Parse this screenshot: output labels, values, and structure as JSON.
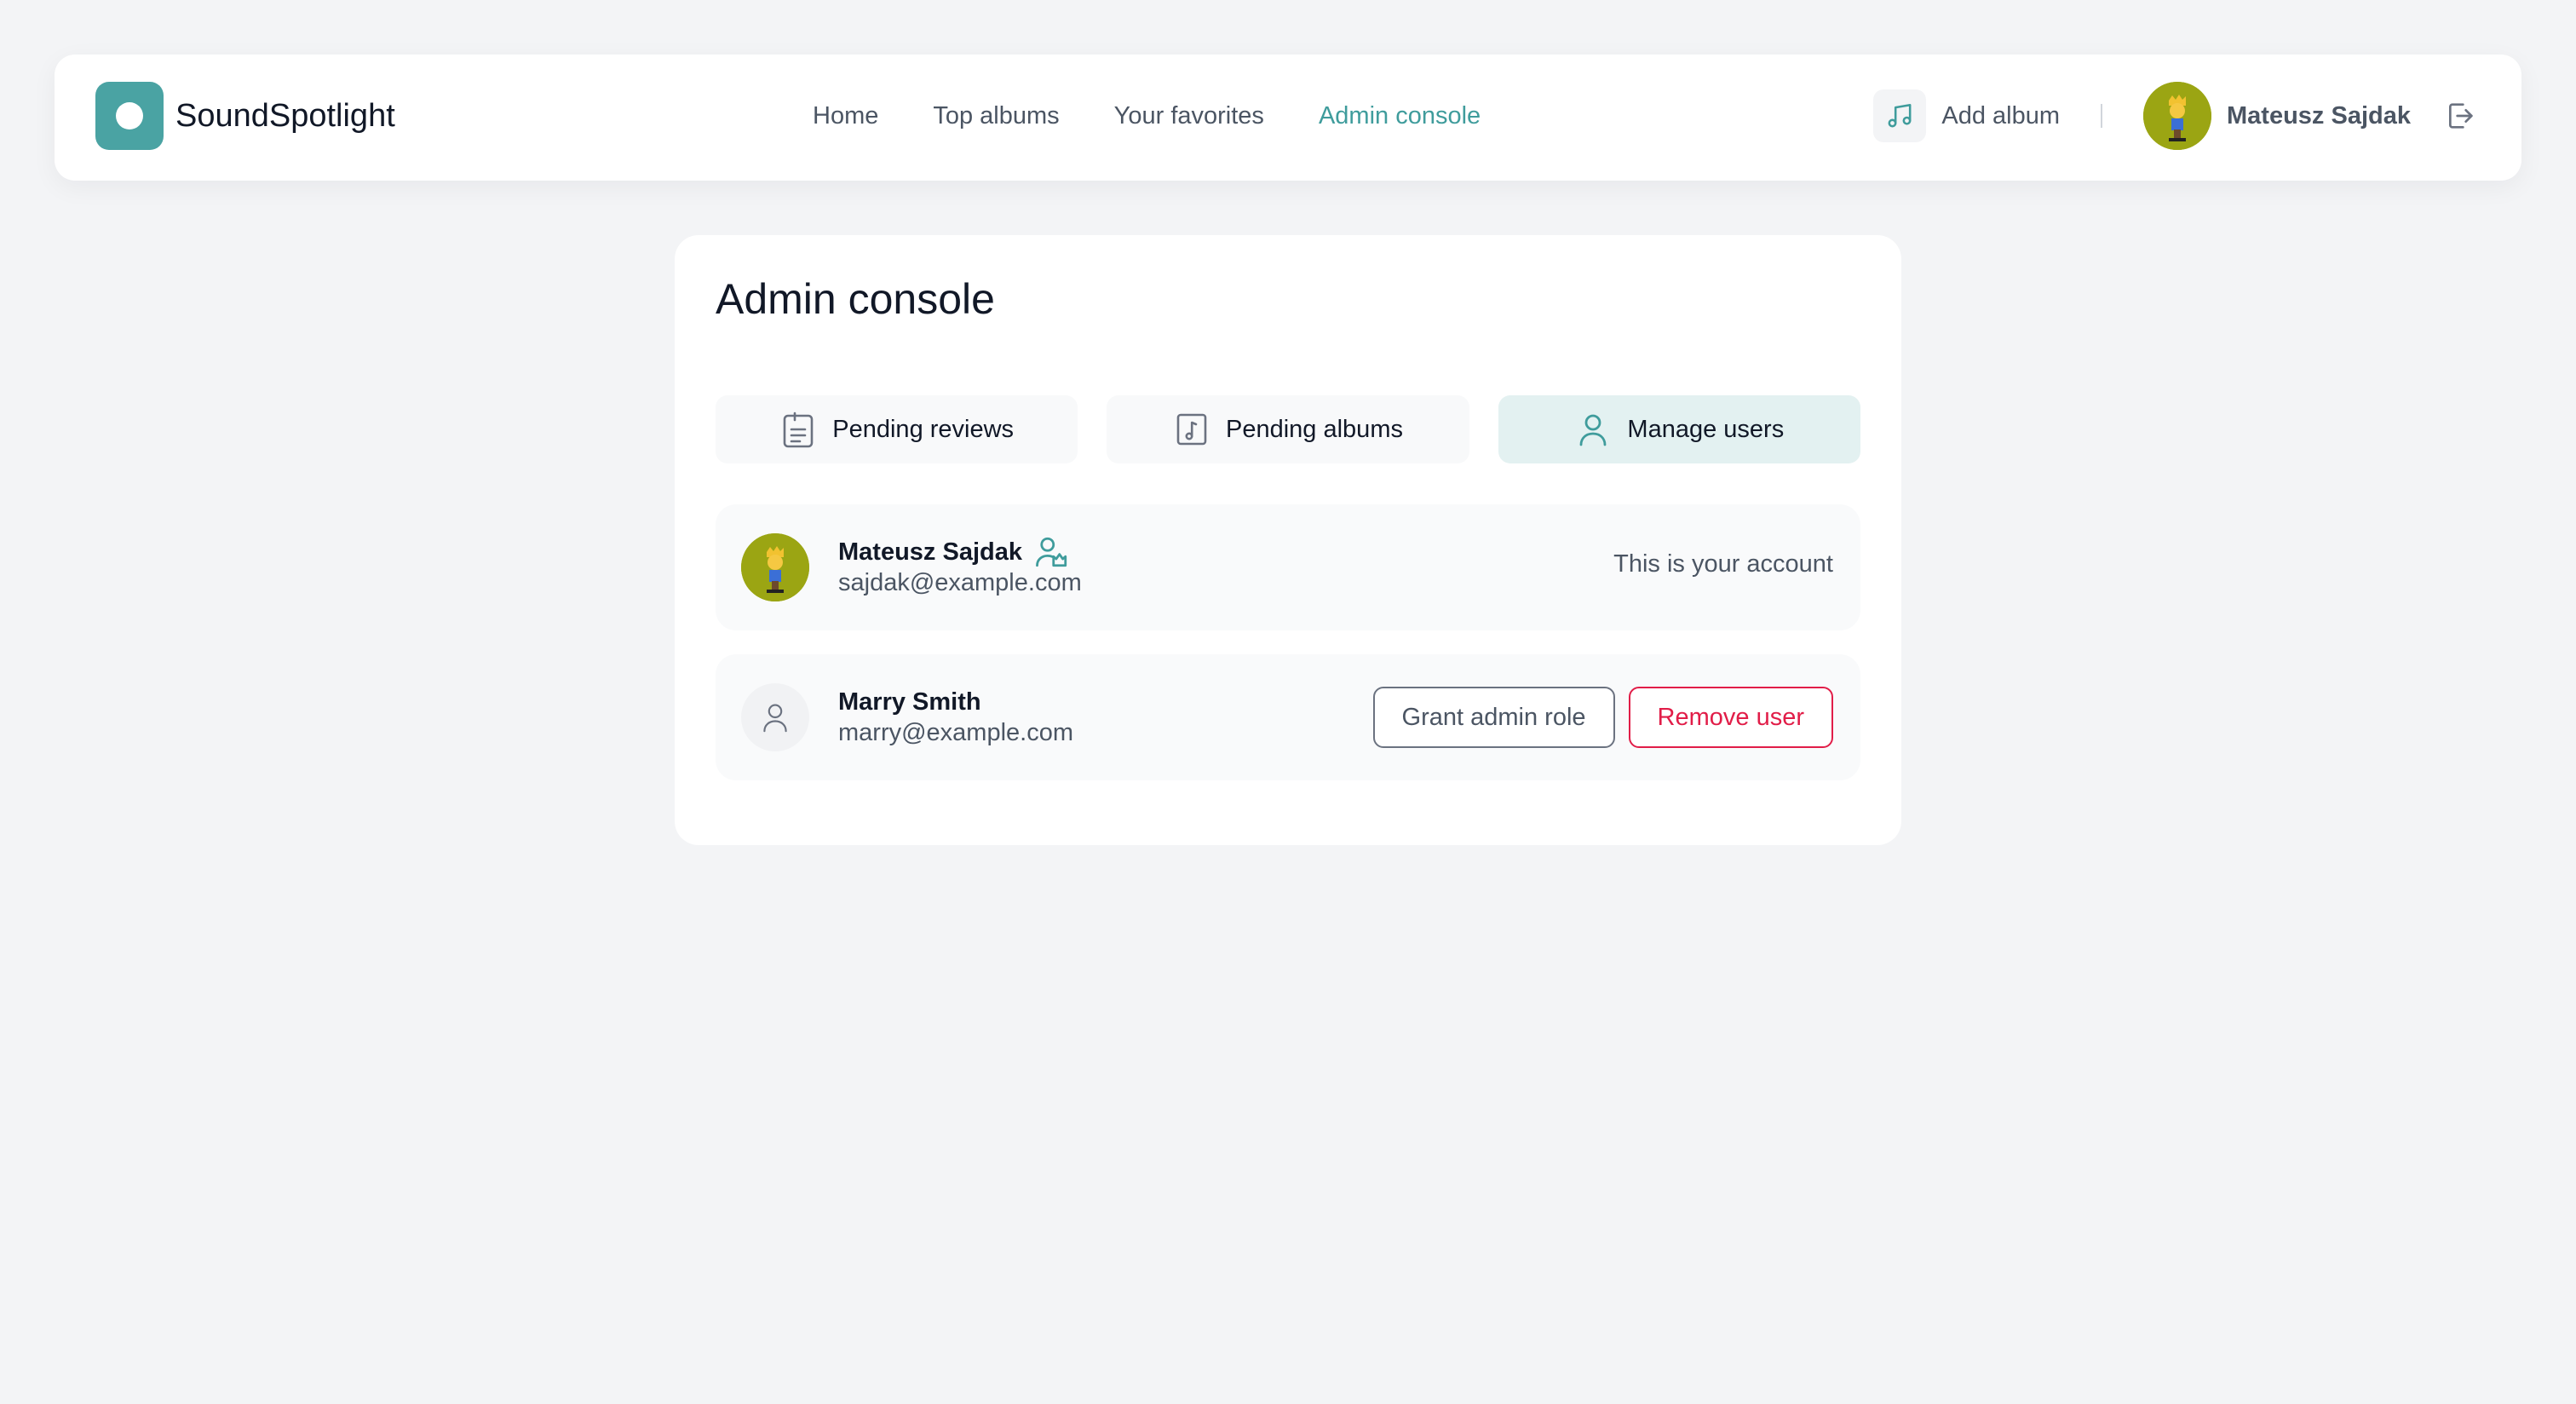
{
  "brand": {
    "name": "SoundSpotlight",
    "color": "#4aa3a3"
  },
  "nav": {
    "links": [
      {
        "label": "Home",
        "active": false
      },
      {
        "label": "Top albums",
        "active": false
      },
      {
        "label": "Your favorites",
        "active": false
      },
      {
        "label": "Admin console",
        "active": true
      }
    ],
    "add_album_label": "Add album",
    "add_album_icon": "music-note-icon",
    "user_name": "Mateusz Sajdak",
    "logout_icon": "logout-icon"
  },
  "admin": {
    "title": "Admin console",
    "tabs": [
      {
        "label": "Pending reviews",
        "icon": "clipboard-list-icon",
        "active": false
      },
      {
        "label": "Pending albums",
        "icon": "music-file-icon",
        "active": false
      },
      {
        "label": "Manage users",
        "icon": "user-icon",
        "active": true
      }
    ],
    "users": [
      {
        "name": "Mateusz Sajdak",
        "email": "sajdak@example.com",
        "is_admin": true,
        "is_current": true,
        "status_text": "This is your account"
      },
      {
        "name": "Marry Smith",
        "email": "marry@example.com",
        "is_admin": false,
        "is_current": false,
        "grant_label": "Grant admin role",
        "remove_label": "Remove user"
      }
    ]
  },
  "colors": {
    "accent": "#3f9c9c",
    "danger": "#e11d48",
    "background": "#f3f4f6"
  }
}
